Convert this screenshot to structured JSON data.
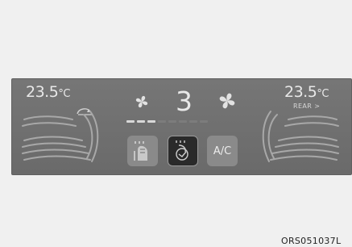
{
  "climate": {
    "left_temp": "23.5",
    "right_temp": "23.5",
    "temp_unit": "°C",
    "rear_label": "REAR",
    "rear_chevron": ">",
    "fan_speed": "3",
    "fan_speed_level": 3,
    "fan_speed_max": 8,
    "ac_label": "A/C"
  },
  "icons": {
    "fan_small": "fan-icon",
    "fan_large": "fan-icon",
    "recirculation": "recirculation-icon",
    "seat_heat_left": "seat-heat-icon",
    "seat_heat_right": "seat-heat-icon",
    "defrost_button": "rear-defrost-icon",
    "seat_button": "heated-seat-icon"
  },
  "caption": "ORS051037L"
}
